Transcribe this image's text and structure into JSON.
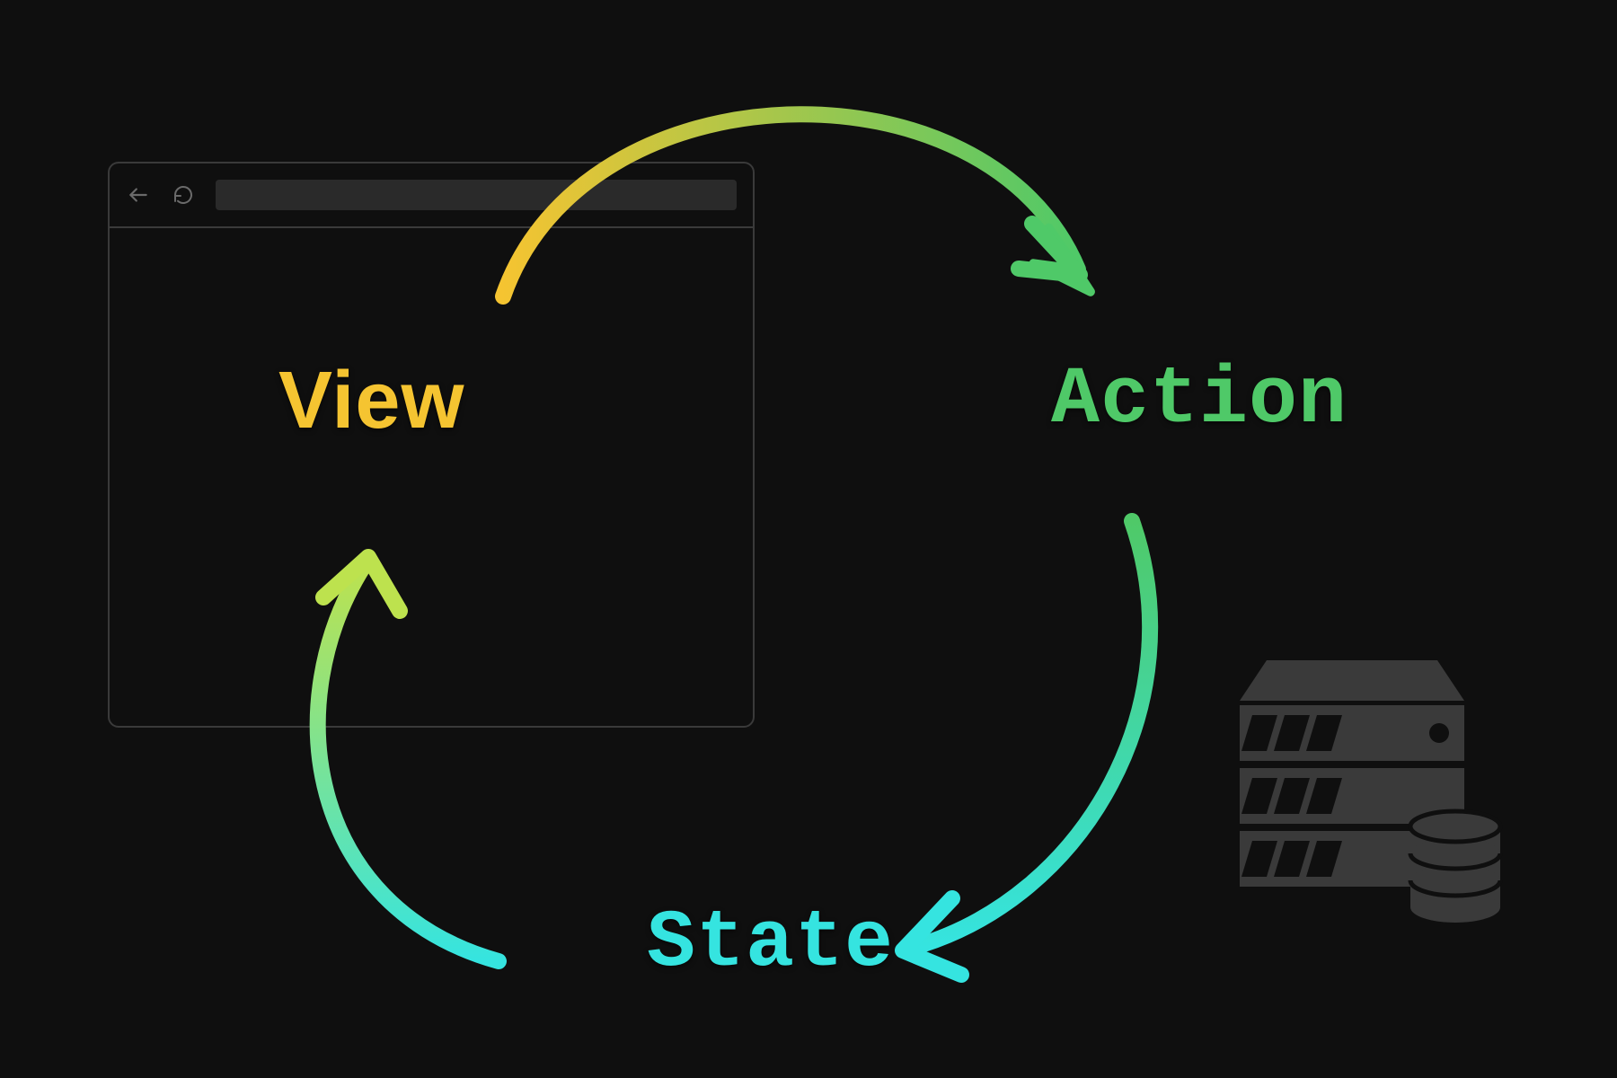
{
  "diagram": {
    "nodes": {
      "view": {
        "label": "View",
        "color": "#f5c431"
      },
      "action": {
        "label": "Action",
        "color": "#4fc968"
      },
      "state": {
        "label": "State",
        "color": "#35e4e0"
      }
    },
    "edges": [
      {
        "from": "view",
        "to": "action",
        "gradient": [
          "#f5c431",
          "#4fc968"
        ]
      },
      {
        "from": "action",
        "to": "state",
        "gradient": [
          "#4fc968",
          "#35e4e0"
        ]
      },
      {
        "from": "state",
        "to": "view",
        "gradient": [
          "#35e4e0",
          "#bde24e"
        ]
      }
    ],
    "icons": {
      "browser": "browser-window-icon",
      "backNav": "back-arrow-icon",
      "refresh": "refresh-icon",
      "server": "server-storage-icon"
    }
  }
}
